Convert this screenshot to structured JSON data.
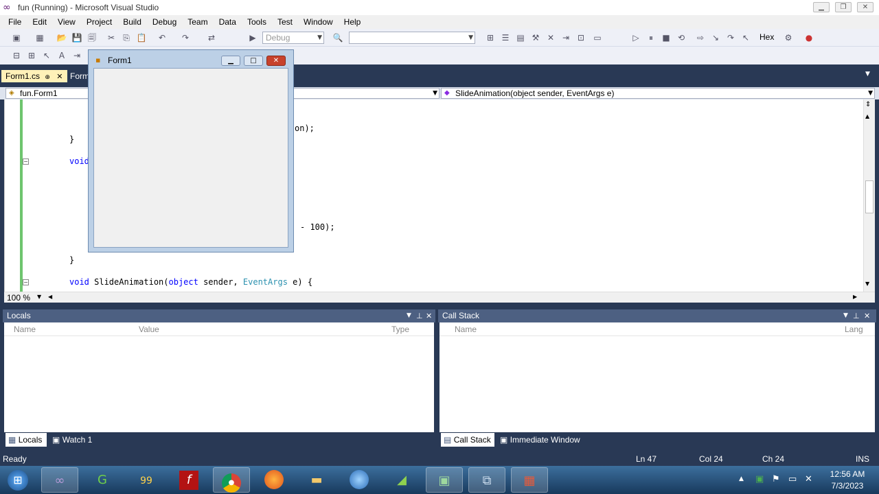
{
  "window": {
    "title": "fun (Running) - Microsoft Visual Studio"
  },
  "menu": [
    "File",
    "Edit",
    "View",
    "Project",
    "Build",
    "Debug",
    "Team",
    "Data",
    "Tools",
    "Test",
    "Window",
    "Help"
  ],
  "toolbar": {
    "config_value": "Debug",
    "platform_value": "",
    "hex_label": "Hex"
  },
  "tabs": [
    {
      "label": "Form1.cs",
      "pin": "⊕",
      "close": "✕"
    },
    {
      "label": "Form"
    }
  ],
  "navbar": {
    "class_combo": "fun.Form1",
    "member_combo": "SlideAnimation(object sender, EventArgs e)"
  },
  "code": {
    "line1": "on);",
    "line2": "}",
    "line3_kw": "void",
    "line4": "- 100);",
    "line5": "}",
    "line6_kw": "void",
    "line6_name": " SlideAnimation(",
    "line6_kw2": "object",
    "line6_mid": " sender, ",
    "line6_type": "EventArgs",
    "line6_end": " e) {"
  },
  "zoom": "100 %",
  "locals": {
    "title": "Locals",
    "cols": [
      "Name",
      "Value",
      "Type"
    ]
  },
  "callstack": {
    "title": "Call Stack",
    "cols": [
      "Name",
      "Lang"
    ]
  },
  "bottom_tabs_left": [
    "Locals",
    "Watch 1"
  ],
  "bottom_tabs_right": [
    "Call Stack",
    "Immediate Window"
  ],
  "status": {
    "text": "Ready",
    "ln": "Ln 47",
    "col": "Col 24",
    "ch": "Ch 24",
    "ins": "INS"
  },
  "form1": {
    "title": "Form1"
  },
  "clock": {
    "time": "12:56 AM",
    "date": "7/3/2023"
  },
  "colors": {
    "accent": "#293955",
    "pane_header": "#4d6082",
    "keyword": "#0000ff",
    "type": "#2b91af"
  }
}
